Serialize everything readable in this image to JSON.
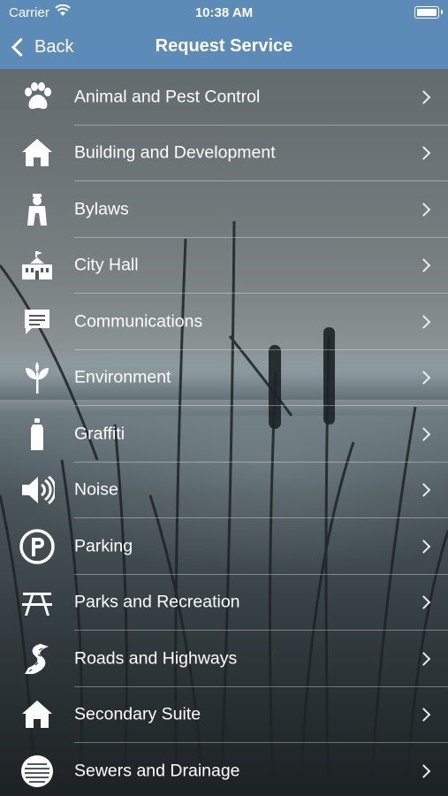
{
  "status_bar": {
    "carrier": "Carrier",
    "time": "10:38 AM"
  },
  "nav_bar": {
    "back_label": "Back",
    "title": "Request Service"
  },
  "services": [
    {
      "label": "Animal and Pest Control",
      "icon": "paw-icon"
    },
    {
      "label": "Building and Development",
      "icon": "house-icon"
    },
    {
      "label": "Bylaws",
      "icon": "officer-icon"
    },
    {
      "label": "City Hall",
      "icon": "city-hall-icon"
    },
    {
      "label": "Communications",
      "icon": "speech-bubble-icon"
    },
    {
      "label": "Environment",
      "icon": "sprout-icon"
    },
    {
      "label": "Graffiti",
      "icon": "spray-can-icon"
    },
    {
      "label": "Noise",
      "icon": "speaker-icon"
    },
    {
      "label": "Parking",
      "icon": "parking-icon"
    },
    {
      "label": "Parks and Recreation",
      "icon": "picnic-table-icon"
    },
    {
      "label": "Roads and Highways",
      "icon": "road-icon"
    },
    {
      "label": "Secondary Suite",
      "icon": "house-icon"
    },
    {
      "label": "Sewers and Drainage",
      "icon": "manhole-icon"
    }
  ],
  "colors": {
    "bar": "#5c8bb7",
    "text": "#ffffff"
  }
}
